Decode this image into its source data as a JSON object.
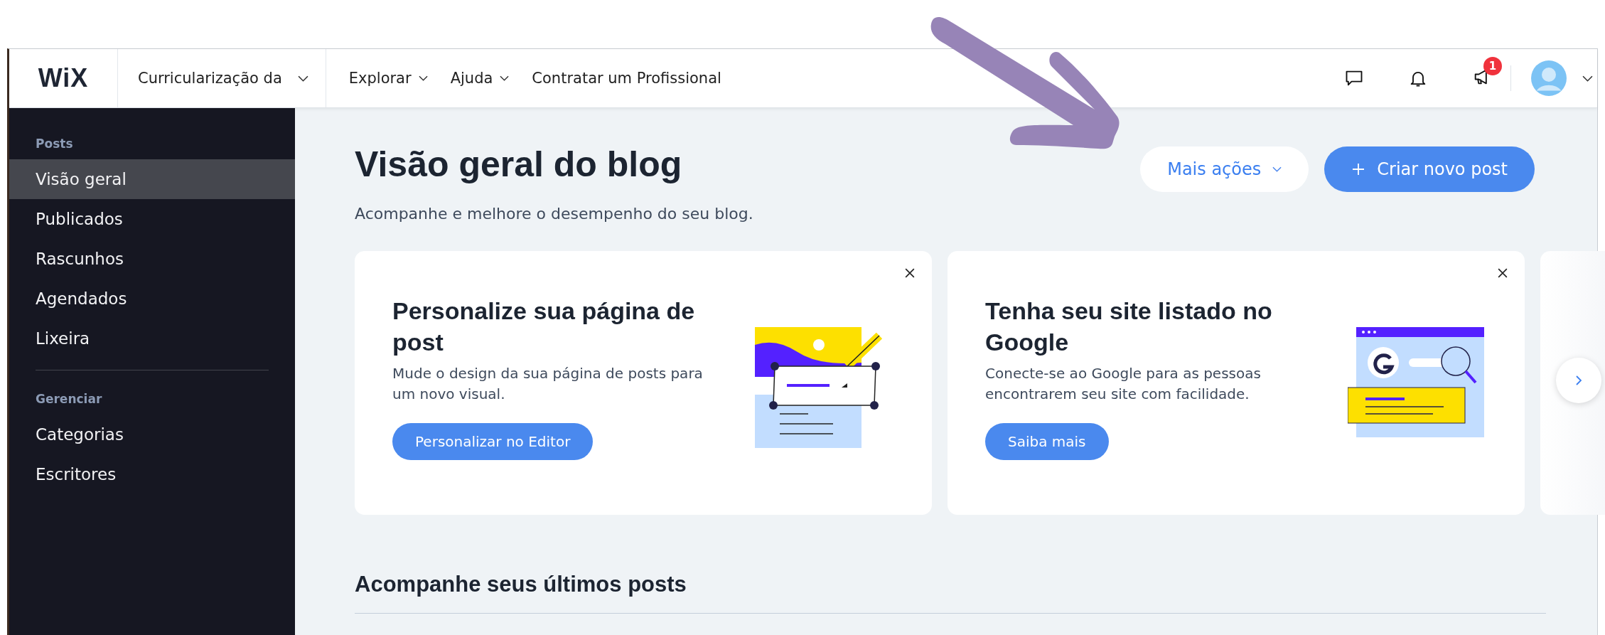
{
  "top_bar": {
    "logo": "WiX",
    "site_name": "Curricularização da",
    "menus": [
      {
        "label": "Explorar",
        "dropdown": true
      },
      {
        "label": "Ajuda",
        "dropdown": true
      },
      {
        "label": "Contratar um Profissional",
        "dropdown": false
      }
    ],
    "notification_badge": "1"
  },
  "sidebar": {
    "sections": [
      {
        "heading": "Posts",
        "items": [
          {
            "label": "Visão geral",
            "selected": true
          },
          {
            "label": "Publicados",
            "selected": false
          },
          {
            "label": "Rascunhos",
            "selected": false
          },
          {
            "label": "Agendados",
            "selected": false
          },
          {
            "label": "Lixeira",
            "selected": false
          }
        ]
      },
      {
        "heading": "Gerenciar",
        "items": [
          {
            "label": "Categorias",
            "selected": false
          },
          {
            "label": "Escritores",
            "selected": false
          }
        ]
      }
    ]
  },
  "header": {
    "title": "Visão geral do blog",
    "subtitle": "Acompanhe e melhore o desempenho do seu blog.",
    "buttons": [
      {
        "label": "Mais ações",
        "kind": "dropdown"
      },
      {
        "label": "Criar novo post",
        "kind": "primary"
      }
    ]
  },
  "cards": [
    {
      "title": "Personalize sua página de post",
      "description": "Mude o design da sua página de posts para um novo visual.",
      "button": "Personalizar no Editor",
      "kind": "editor"
    },
    {
      "title": "Tenha seu site listado no Google",
      "description": "Conecte-se ao Google para as pessoas encontrarem seu site com facilidade.",
      "button": "Saiba mais",
      "kind": "search"
    }
  ],
  "section_title": "Acompanhe seus últimos posts"
}
